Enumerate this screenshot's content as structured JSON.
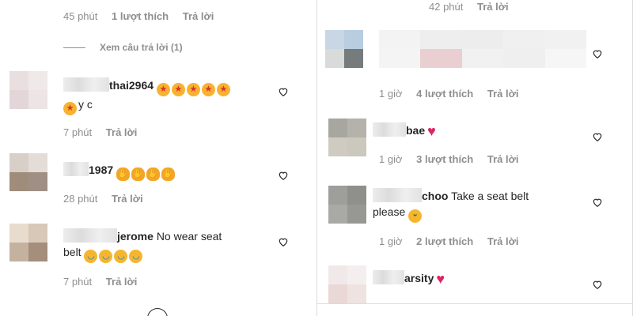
{
  "left": {
    "top_meta": {
      "time": "45 phút",
      "likes": "1 lượt thích",
      "reply": "Trả lời"
    },
    "view_replies": "Xem câu trả lời (1)",
    "comments": [
      {
        "user": "thai2964",
        "text_line2": "y c",
        "time": "7 phút",
        "reply": "Trả lời"
      },
      {
        "user": "1987",
        "time": "28 phút",
        "reply": "Trả lời"
      },
      {
        "user": "jerome",
        "text": "No wear seat",
        "text_line2": "belt",
        "time": "7 phút",
        "reply": "Trả lời"
      }
    ]
  },
  "right": {
    "top_meta": {
      "time": "42 phút",
      "reply": "Trả lời"
    },
    "comments": [
      {
        "time": "1 giờ",
        "likes": "4 lượt thích",
        "reply": "Trả lời"
      },
      {
        "user": "bae",
        "time": "1 giờ",
        "likes": "3 lượt thích",
        "reply": "Trả lời"
      },
      {
        "user": "choo",
        "text": "Take a seat belt",
        "text_line2": "please",
        "time": "1 giờ",
        "likes": "2 lượt thích",
        "reply": "Trả lời"
      },
      {
        "user": "arsity"
      }
    ]
  },
  "icons": {
    "like": "heart-outline-icon",
    "emoji_heart": "red-heart-icon",
    "emoji_star_eyes": "star-struck-emoji-icon",
    "emoji_clap": "clapping-hands-emoji-icon",
    "emoji_laugh": "tears-of-joy-emoji-icon",
    "emoji_wink": "winking-face-emoji-icon"
  },
  "colors": {
    "meta_text": "#8e8e8e",
    "text": "#262626",
    "heart": "#e0245e",
    "border": "#dbdbdb"
  }
}
